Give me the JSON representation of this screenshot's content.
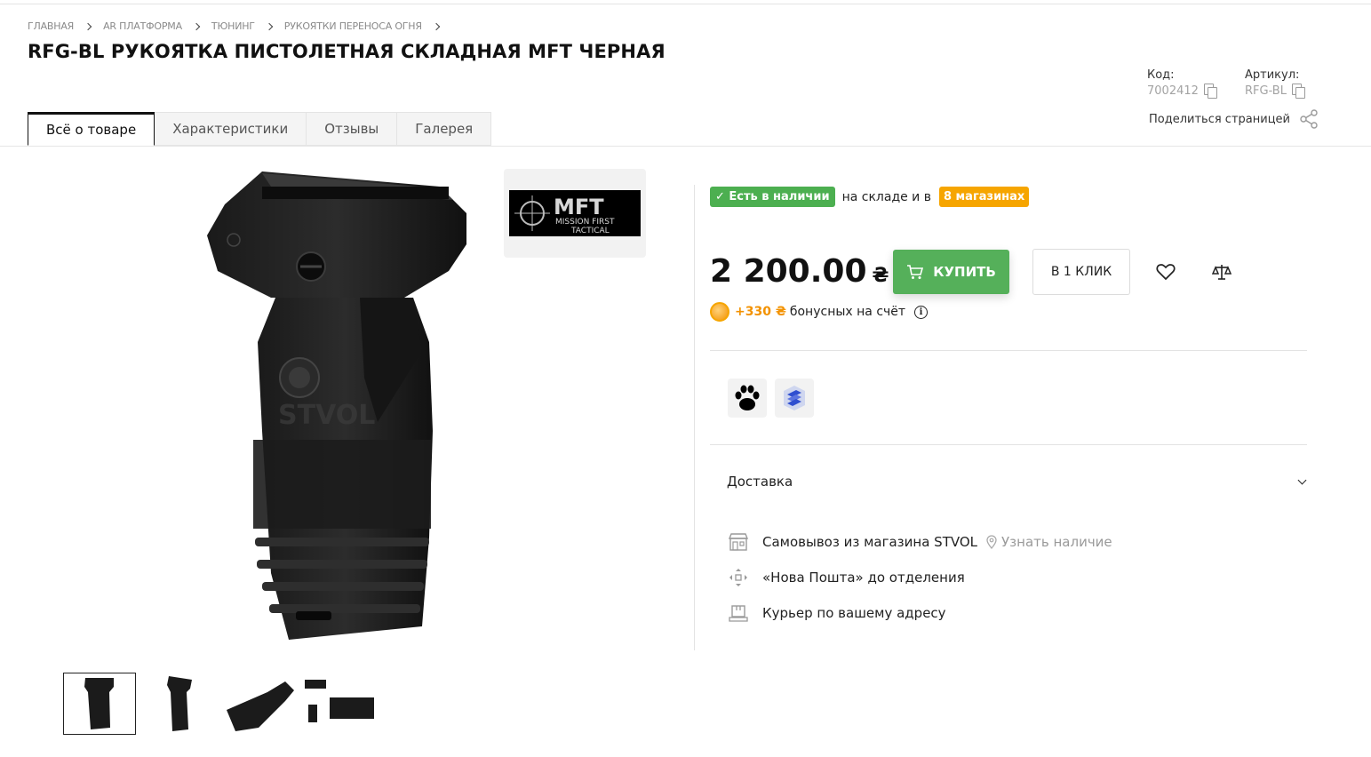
{
  "breadcrumb": [
    "Главная",
    "AR платформа",
    "Тюнинг",
    "Рукоятки переноса огня"
  ],
  "product": {
    "title": "RFG-BL РУКОЯТКА ПИСТОЛЕТНАЯ СКЛАДНАЯ MFT ЧЕРНАЯ",
    "code_label": "Код:",
    "code": "7002412",
    "article_label": "Артикул:",
    "article": "RFG-BL",
    "share_label": "Поделиться страницей"
  },
  "tabs": [
    "Всё о товаре",
    "Характеристики",
    "Отзывы",
    "Галерея"
  ],
  "gallery": {
    "brand": {
      "line1": "MFT",
      "line2": "MISSION FIRST",
      "line3": "TACTICAL"
    },
    "watermark": "STVOL",
    "thumb_count": 4
  },
  "availability": {
    "badge": "✓ Есть в наличии",
    "text": "на складе и в",
    "stores": "8 магазинах"
  },
  "price": {
    "value": "2 200.00",
    "currency": "₴"
  },
  "buttons": {
    "buy": "КУПИТЬ",
    "one_click": "В 1 КЛИК"
  },
  "bonus": {
    "amount": "+330 ₴",
    "text": "бонусных на счёт"
  },
  "delivery": {
    "title": "Доставка",
    "options": [
      {
        "text": "Самовывоз из магазина STVOL",
        "link": "Узнать наличие",
        "icon": "store-icon"
      },
      {
        "text": "«Нова Пошта» до отделения",
        "icon": "parcel-icon"
      },
      {
        "text": "Курьер по вашему адресу",
        "icon": "courier-icon"
      }
    ]
  },
  "colors": {
    "accent_green": "#55b05a",
    "badge_orange": "#f6a500",
    "bonus_orange": "#f39200"
  }
}
